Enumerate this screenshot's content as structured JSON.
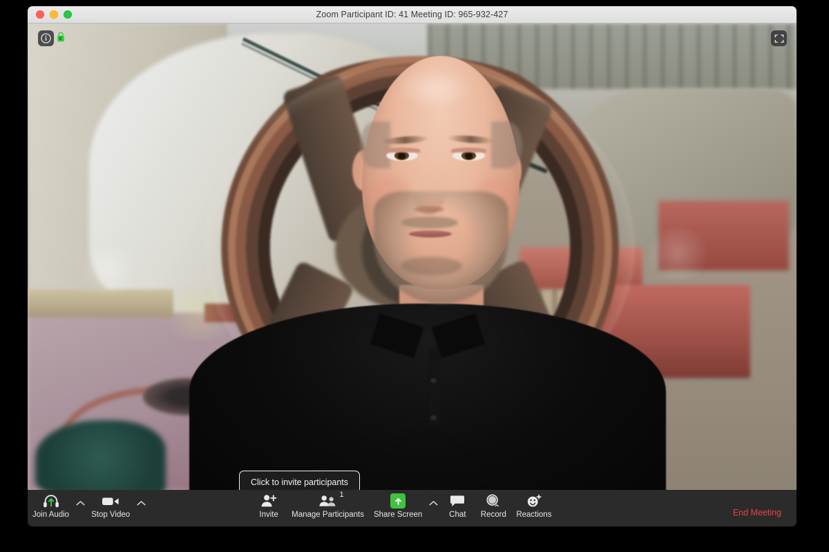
{
  "window": {
    "title": "Zoom Participant ID: 41   Meeting ID: 965-932-427",
    "traffic_lights": [
      "close",
      "minimize",
      "zoom"
    ]
  },
  "video_overlay": {
    "info_icon": "info-icon",
    "info_glyph": "i",
    "encryption_icon": "lock-icon",
    "encryption_letter": "E",
    "encryption_color": "#35d13b",
    "fullscreen_icon": "fullscreen-icon"
  },
  "tooltip": {
    "text": "Click to invite participants"
  },
  "toolbar": {
    "background_color": "#2b2b2b",
    "items": [
      {
        "label": "Join Audio",
        "icon": "headphone-icon",
        "caret": true,
        "badge": null
      },
      {
        "label": "Stop Video",
        "icon": "video-camera-icon",
        "caret": true,
        "badge": null
      },
      {
        "label": "Invite",
        "icon": "person-add-icon",
        "caret": false,
        "badge": null
      },
      {
        "label": "Manage Participants",
        "icon": "people-icon",
        "caret": false,
        "badge": "1"
      },
      {
        "label": "Share Screen",
        "icon": "share-screen-icon",
        "caret": true,
        "badge": null
      },
      {
        "label": "Chat",
        "icon": "chat-bubble-icon",
        "caret": false,
        "badge": null
      },
      {
        "label": "Record",
        "icon": "record-circle-icon",
        "caret": false,
        "badge": null
      },
      {
        "label": "Reactions",
        "icon": "smiley-plus-icon",
        "caret": false,
        "badge": null
      }
    ],
    "end_meeting": {
      "label": "End Meeting",
      "color": "#e8453c"
    }
  },
  "video": {
    "participant": "bald man with short grey beard wearing a black polo shirt",
    "virtual_background": "blurred industrial machine room with large rusty flywheel, pipes and red painted machinery"
  }
}
